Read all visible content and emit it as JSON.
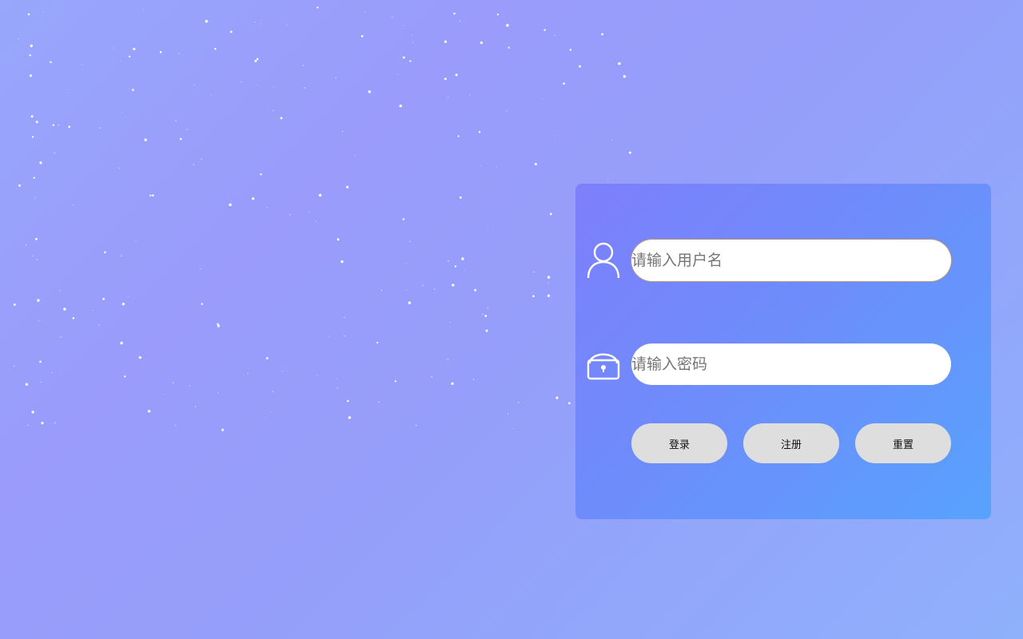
{
  "theme": {
    "panel_gradient_start": "#7e7ffb",
    "panel_gradient_end": "#58a2fd",
    "button_bg": "#dedede",
    "input_bg": "#ffffff",
    "icon_color": "#ffffff"
  },
  "login_form": {
    "username": {
      "icon": "user-icon",
      "placeholder": "请输入用户名",
      "value": ""
    },
    "password": {
      "icon": "lock-icon",
      "placeholder": "请输入密码",
      "value": ""
    },
    "buttons": {
      "login_label": "登录",
      "register_label": "注册",
      "reset_label": "重置"
    }
  }
}
